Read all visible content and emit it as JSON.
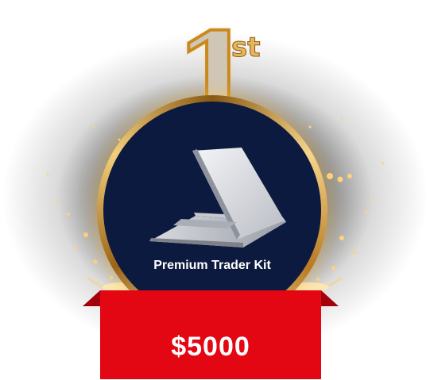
{
  "badge": {
    "rank_number": "1",
    "rank_suffix": "st"
  },
  "prize": {
    "product_name": "Premium Trader Kit",
    "price": "$5000",
    "image_icon": "laptop-icon"
  },
  "colors": {
    "medal_face": "#0d1a3f",
    "gold": "#e8b65a",
    "banner_red": "#e30613"
  }
}
